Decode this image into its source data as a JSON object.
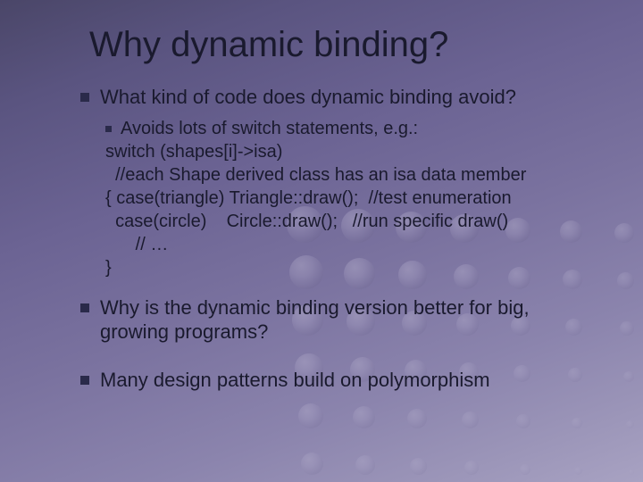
{
  "title": "Why dynamic binding?",
  "bullets": [
    {
      "text": "What kind of code does dynamic binding avoid?",
      "sub": {
        "lead": "Avoids lots of switch statements, e.g.:",
        "code": [
          "switch (shapes[i]->isa)",
          "  //each Shape derived class has an isa data member",
          "{ case(triangle) Triangle::draw();  //test enumeration",
          "  case(circle)    Circle::draw();   //run specific draw()",
          "   // …",
          "}"
        ]
      }
    },
    {
      "text": "Why is the dynamic binding version better for big, growing programs?"
    },
    {
      "text": "Many design patterns build on polymorphism"
    }
  ]
}
